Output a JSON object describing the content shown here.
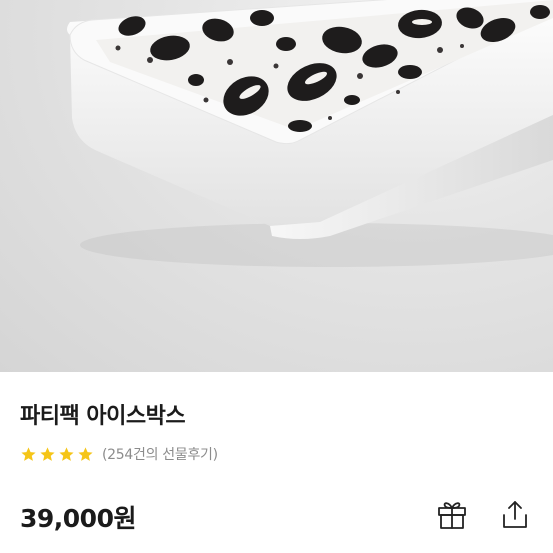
{
  "product": {
    "image": {
      "subject": "oreo-ice-cream-box",
      "icon": "product-photo"
    },
    "title": "파티팩 아이스박스",
    "rating": {
      "stars": 4,
      "review_count_text": "(254건의 선물후기)",
      "star_color": "#f5c518"
    },
    "price": "39,000원"
  },
  "actions": {
    "gift_icon": "gift-icon",
    "share_icon": "share-icon"
  }
}
